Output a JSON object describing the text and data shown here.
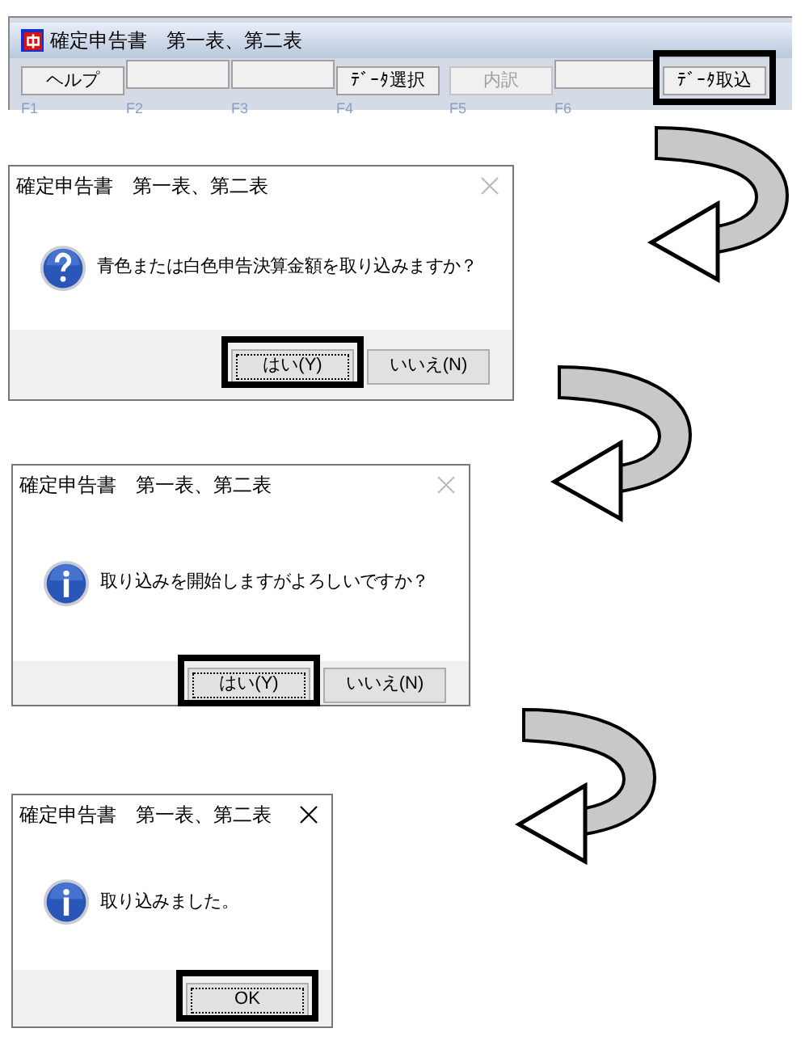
{
  "app_window": {
    "title": "確定申告書　第一表、第二表",
    "buttons": [
      {
        "label": "ヘルプ",
        "disabled": false,
        "highlighted": false
      },
      {
        "disabled": false,
        "highlighted": false
      },
      {
        "disabled": false,
        "highlighted": false
      },
      {
        "label": "ﾃﾞｰﾀ選択",
        "disabled": false,
        "highlighted": false
      },
      {
        "label": "内訳",
        "disabled": true,
        "highlighted": false
      },
      {
        "disabled": false,
        "highlighted": false
      },
      {
        "label": "ﾃﾞｰﾀ取込",
        "disabled": false,
        "highlighted": true
      }
    ],
    "function_keys": [
      "F1",
      "F2",
      "F3",
      "F4",
      "F5",
      "F6"
    ]
  },
  "dialogs": [
    {
      "title": "確定申告書　第一表、第二表",
      "close_enabled": false,
      "kind": "question",
      "message": "青色または白色申告決算金額を取り込みますか？",
      "buttons": [
        {
          "label": "はい(Y)",
          "highlighted": true
        },
        {
          "label": "いいえ(N)",
          "highlighted": false
        }
      ]
    },
    {
      "title": "確定申告書　第一表、第二表",
      "close_enabled": false,
      "kind": "info",
      "message": "取り込みを開始しますがよろしいですか？",
      "buttons": [
        {
          "label": "はい(Y)",
          "highlighted": true
        },
        {
          "label": "いいえ(N)",
          "highlighted": false
        }
      ]
    },
    {
      "title": "確定申告書　第一表、第二表",
      "close_enabled": true,
      "kind": "info",
      "message": "取り込みました。",
      "buttons": [
        {
          "label": "OK",
          "highlighted": true
        }
      ]
    }
  ]
}
